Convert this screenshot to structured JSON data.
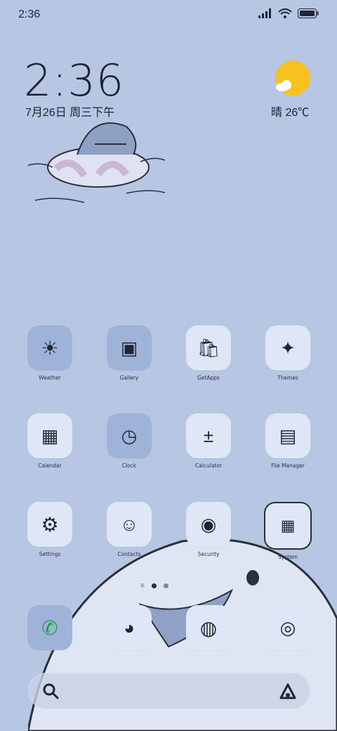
{
  "status_bar": {
    "time": "2:36",
    "icons": [
      "signal-icon",
      "wifi-icon",
      "battery-icon"
    ]
  },
  "clock_widget": {
    "time": "2:36",
    "date": "7月26日 周三下午"
  },
  "weather_widget": {
    "condition_temp": "晴 26℃",
    "icon": "sun-cloud-icon"
  },
  "apps": [
    {
      "label": "Weather",
      "icon": "weather-icon"
    },
    {
      "label": "Gallery",
      "icon": "gallery-icon"
    },
    {
      "label": "GetApps",
      "icon": "getapps-icon"
    },
    {
      "label": "Themes",
      "icon": "themes-icon"
    },
    {
      "label": "Calendar",
      "icon": "calendar-icon"
    },
    {
      "label": "Clock",
      "icon": "clock-icon"
    },
    {
      "label": "Calculator",
      "icon": "calculator-icon"
    },
    {
      "label": "File Manager",
      "icon": "file-manager-icon"
    },
    {
      "label": "Settings",
      "icon": "settings-icon"
    },
    {
      "label": "Contacts",
      "icon": "contacts-icon"
    },
    {
      "label": "Security",
      "icon": "security-icon"
    },
    {
      "label": "System",
      "icon": "system-icon"
    }
  ],
  "dock": [
    {
      "icon": "phone-icon"
    },
    {
      "icon": "messages-icon"
    },
    {
      "icon": "browser-icon"
    },
    {
      "icon": "camera-icon"
    }
  ],
  "pager": {
    "current": 1,
    "count": 2
  },
  "colors": {
    "wallpaper": "#b7c6e2",
    "sun": "#f6c21d",
    "tile": "#dfe7f6",
    "tile_dark": "#9fb3d8"
  }
}
